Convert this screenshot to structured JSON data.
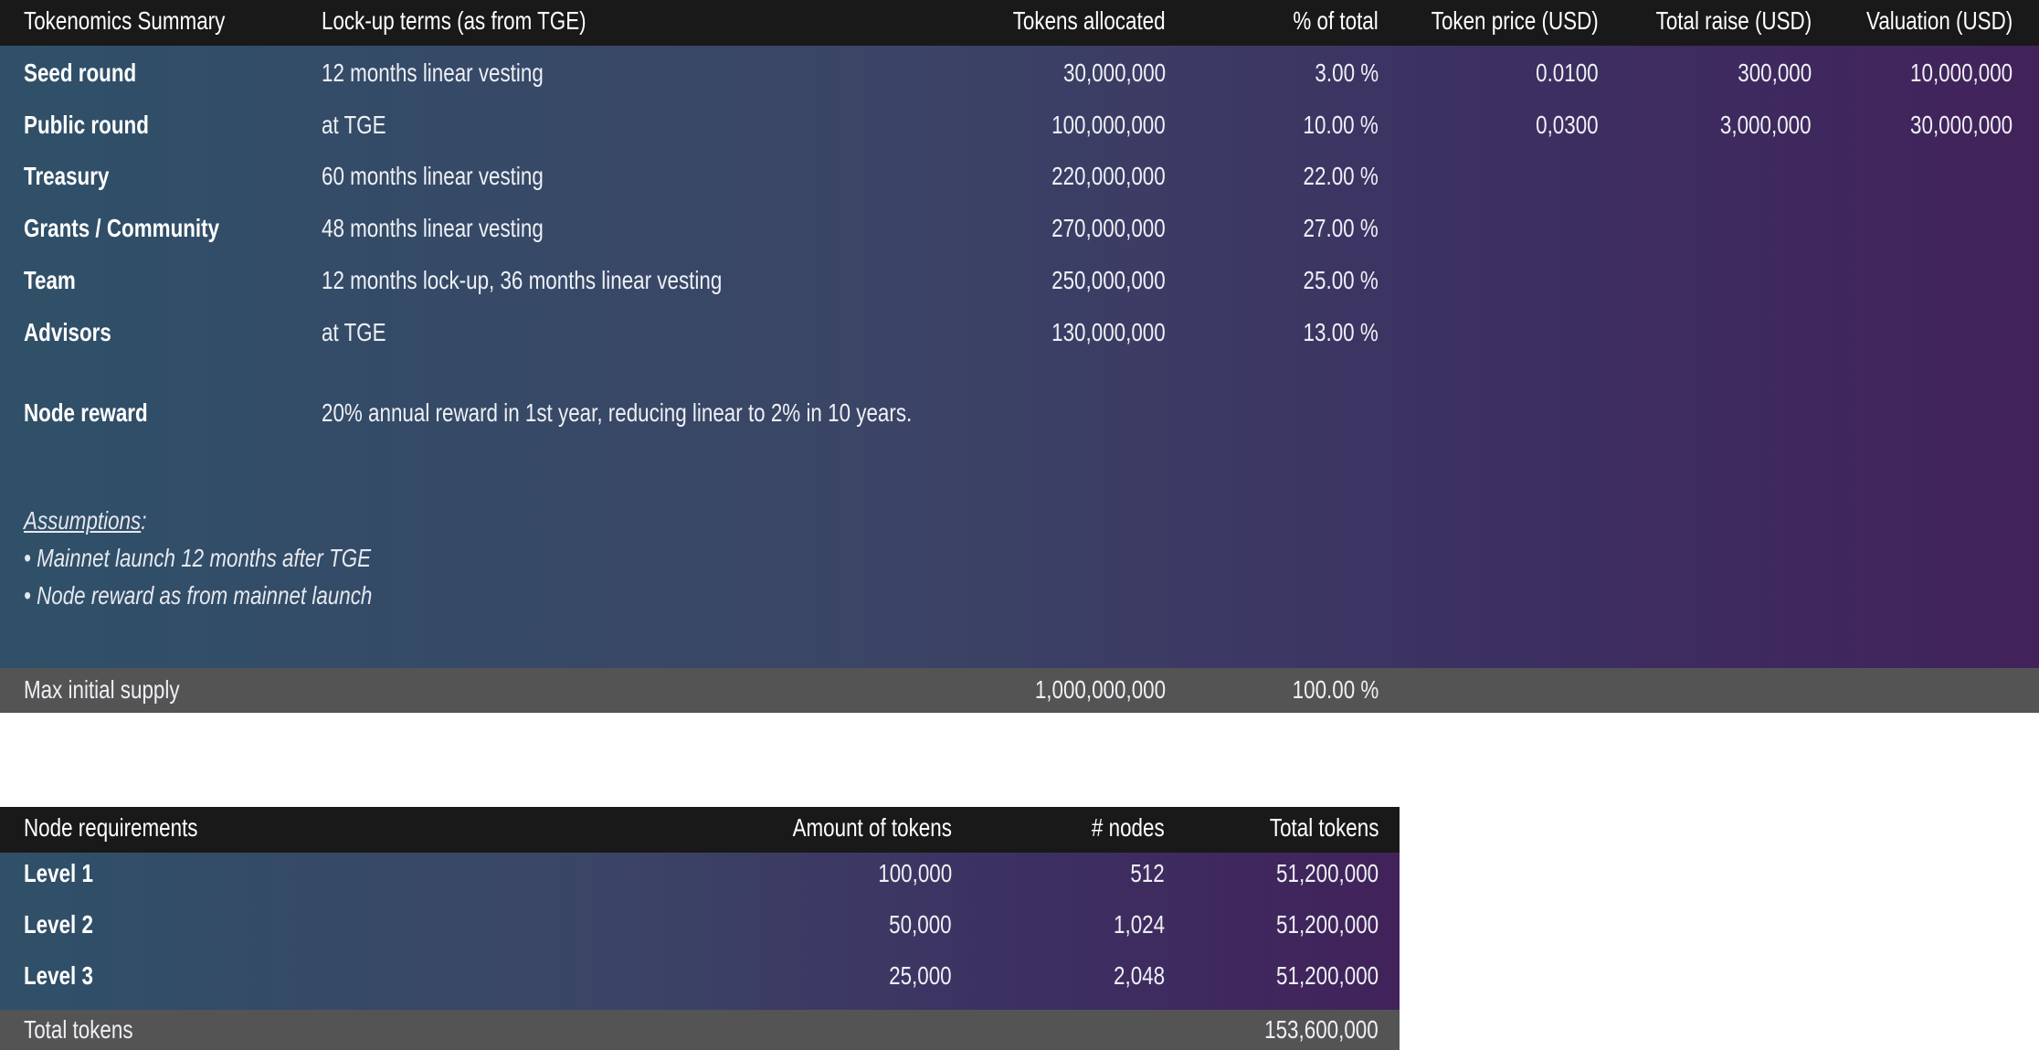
{
  "tokenomics": {
    "headers": {
      "title": "Tokenomics Summary",
      "lockup": "Lock-up terms (as from TGE)",
      "tokens": "Tokens allocated",
      "pct": "% of total",
      "price": "Token price (USD)",
      "raise": "Total raise (USD)",
      "valuation": "Valuation (USD)"
    },
    "rows": [
      {
        "label": "Seed round",
        "terms": "12 months linear vesting",
        "tokens": "30,000,000",
        "pct": "3.00 %",
        "price": "0.0100",
        "raise": "300,000",
        "valuation": "10,000,000"
      },
      {
        "label": "Public round",
        "terms": "at TGE",
        "tokens": "100,000,000",
        "pct": "10.00 %",
        "price": "0,0300",
        "raise": "3,000,000",
        "valuation": "30,000,000"
      },
      {
        "label": "Treasury",
        "terms": "60 months linear vesting",
        "tokens": "220,000,000",
        "pct": "22.00 %"
      },
      {
        "label": "Grants / Community",
        "terms": "48 months linear vesting",
        "tokens": "270,000,000",
        "pct": "27.00 %"
      },
      {
        "label": "Team",
        "terms": "12 months lock-up, 36 months linear vesting",
        "tokens": "250,000,000",
        "pct": "25.00 %"
      },
      {
        "label": "Advisors",
        "terms": "at TGE",
        "tokens": "130,000,000",
        "pct": "13.00 %"
      }
    ],
    "node_reward": {
      "label": "Node reward",
      "terms": "20% annual reward in 1st year, reducing linear to 2% in 10 years."
    },
    "assumptions": {
      "title": "Assumptions",
      "colon": ":",
      "items": [
        "• Mainnet launch 12 months after TGE",
        "• Node reward as from mainnet launch"
      ]
    },
    "footer": {
      "label": "Max initial supply",
      "tokens": "1,000,000,000",
      "pct": "100.00 %"
    }
  },
  "node_requirements": {
    "headers": {
      "title": "Node requirements",
      "amount": "Amount of tokens",
      "nodes": "# nodes",
      "total": "Total tokens"
    },
    "rows": [
      {
        "label": "Level 1",
        "amount": "100,000",
        "nodes": "512",
        "total": "51,200,000"
      },
      {
        "label": "Level 2",
        "amount": "50,000",
        "nodes": "1,024",
        "total": "51,200,000"
      },
      {
        "label": "Level 3",
        "amount": "25,000",
        "nodes": "2,048",
        "total": "51,200,000"
      }
    ],
    "footer": {
      "label": "Total tokens",
      "total": "153,600,000"
    }
  },
  "colors": {
    "header_bg": "#191919",
    "footer_bg": "#545454",
    "gradient_start": "#2f5068",
    "gradient_end": "#41225a"
  }
}
